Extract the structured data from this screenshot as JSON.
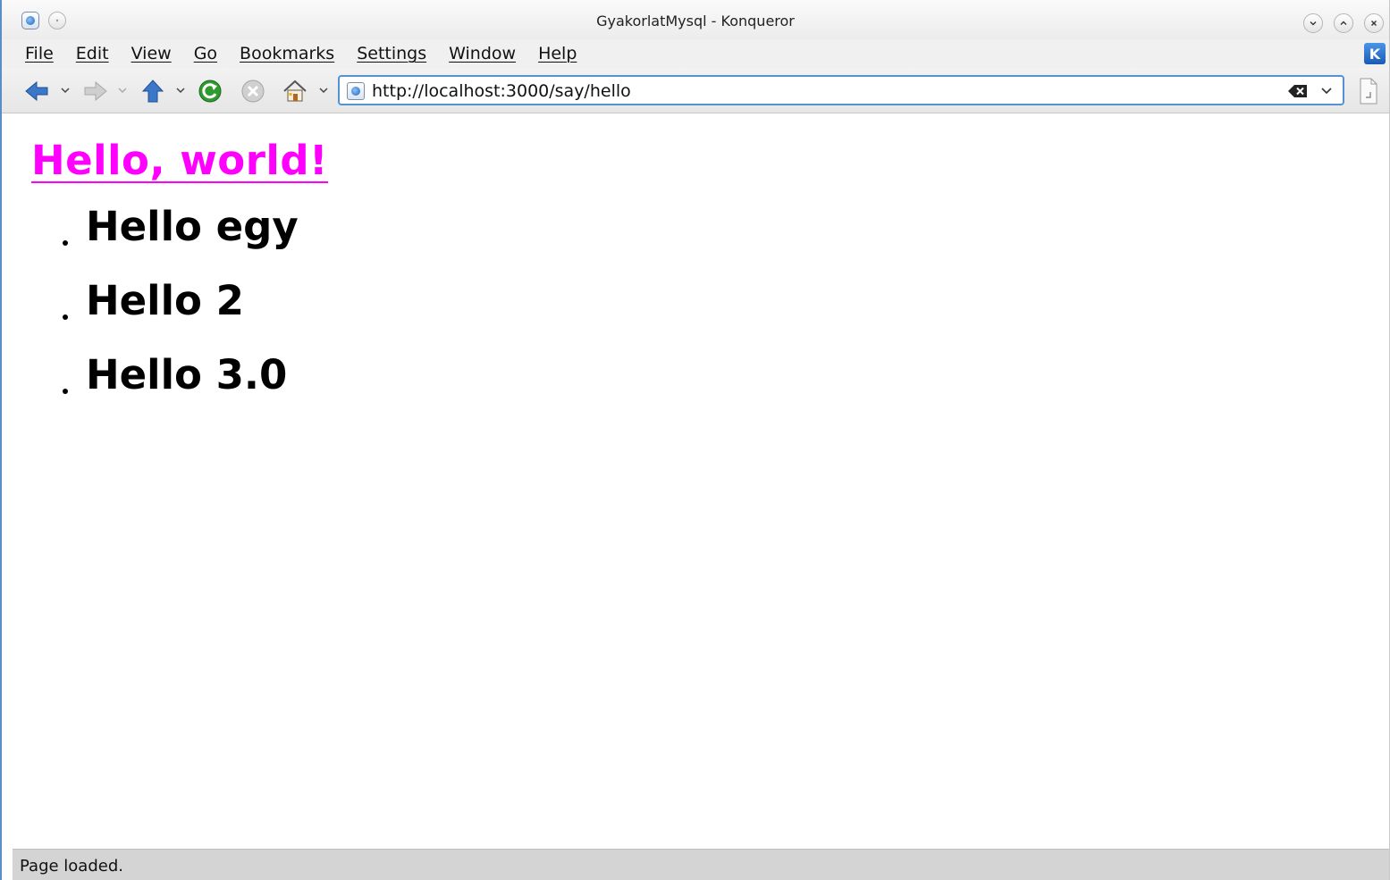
{
  "window": {
    "title": "GyakorlatMysql - Konqueror"
  },
  "menu": [
    "File",
    "Edit",
    "View",
    "Go",
    "Bookmarks",
    "Settings",
    "Window",
    "Help"
  ],
  "toolbar": {
    "icons": [
      "back-arrow-icon",
      "forward-arrow-icon",
      "up-arrow-icon",
      "reload-icon",
      "stop-icon",
      "home-icon"
    ],
    "url": "http://localhost:3000/say/hello"
  },
  "page": {
    "headline": "Hello, world!",
    "items": [
      "Hello egy",
      "Hello 2",
      "Hello 3.0"
    ],
    "headline_color": "#ff00ff"
  },
  "status": {
    "text": "Page loaded."
  },
  "colors": {
    "accent": "#5591d6",
    "statusbar": "#d4d4d4"
  }
}
